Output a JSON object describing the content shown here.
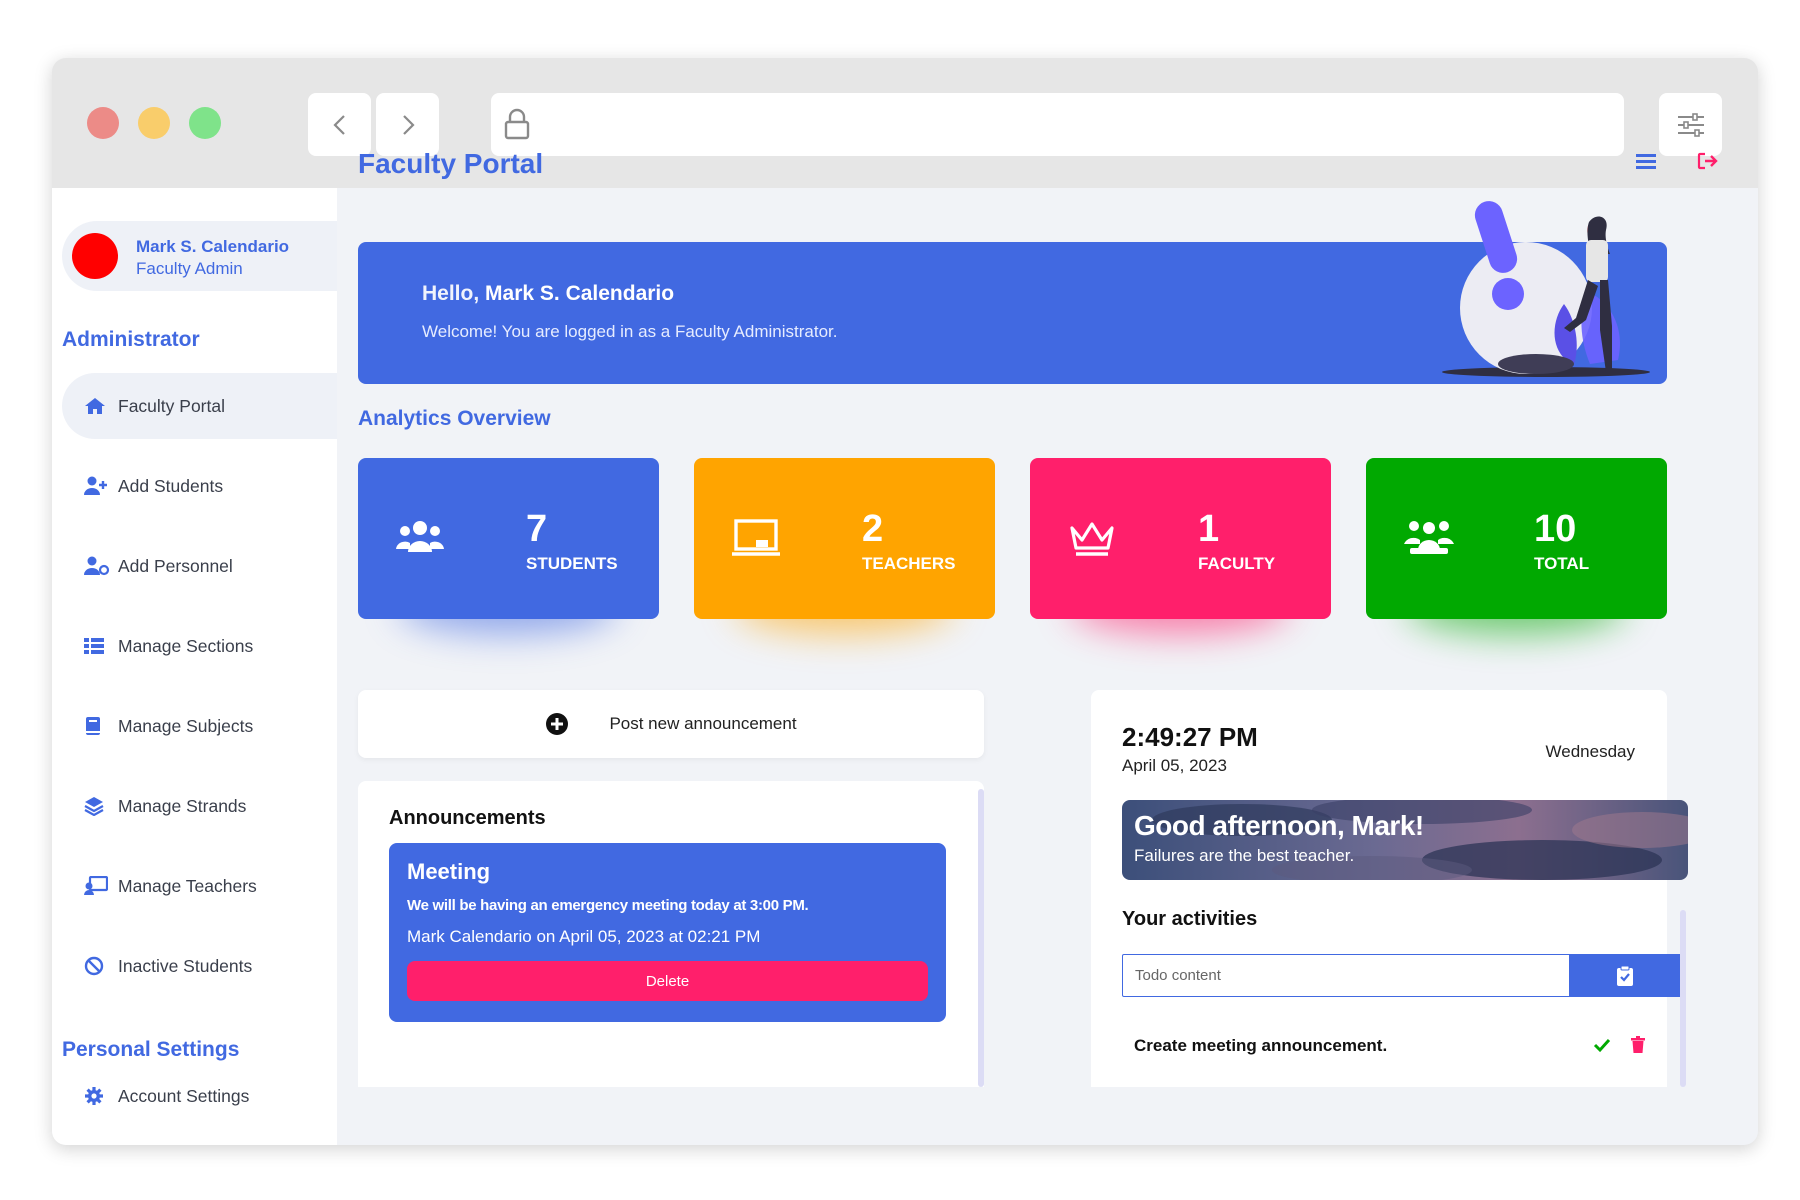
{
  "user": {
    "name": "Mark S. Calendario",
    "role": "Faculty Admin",
    "avatar_color": "#ff0000"
  },
  "sidebar": {
    "section_admin": "Administrator",
    "items": [
      {
        "label": "Faculty Portal",
        "icon": "home-icon"
      },
      {
        "label": "Add Students",
        "icon": "user-plus-icon"
      },
      {
        "label": "Add Personnel",
        "icon": "user-cog-icon"
      },
      {
        "label": "Manage Sections",
        "icon": "list-icon"
      },
      {
        "label": "Manage Subjects",
        "icon": "book-icon"
      },
      {
        "label": "Manage Strands",
        "icon": "layers-icon"
      },
      {
        "label": "Manage Teachers",
        "icon": "teacher-icon"
      },
      {
        "label": "Inactive Students",
        "icon": "ban-icon"
      }
    ],
    "section_personal": "Personal Settings",
    "personal_items": [
      {
        "label": "Account Settings",
        "icon": "gear-icon"
      }
    ]
  },
  "header": {
    "title": "Faculty Portal"
  },
  "hero": {
    "hello": "Hello,",
    "name": "Mark S. Calendario",
    "welcome": "Welcome! You are logged in as a Faculty Administrator."
  },
  "analytics": {
    "title": "Analytics Overview",
    "cards": [
      {
        "value": "7",
        "label": "STUDENTS",
        "color": "#4169e1",
        "icon": "users-icon"
      },
      {
        "value": "2",
        "label": "TEACHERS",
        "color": "#ffa400",
        "icon": "chalkboard-icon"
      },
      {
        "value": "1",
        "label": "FACULTY",
        "color": "#ff1f6b",
        "icon": "crown-icon"
      },
      {
        "value": "10",
        "label": "TOTAL",
        "color": "#01a901",
        "icon": "group-icon"
      }
    ]
  },
  "announcements": {
    "post_label": "Post new announcement",
    "title": "Announcements",
    "items": [
      {
        "title": "Meeting",
        "body": "We will be having an emergency meeting today at 3:00 PM.",
        "meta": "Mark Calendario on April 05, 2023 at 02:21 PM",
        "delete_label": "Delete"
      }
    ]
  },
  "clock": {
    "time": "2:49:27 PM",
    "date": "April 05, 2023",
    "weekday": "Wednesday"
  },
  "greeting": {
    "title": "Good afternoon, Mark!",
    "quote": "Failures are the best teacher."
  },
  "activities": {
    "title": "Your activities",
    "placeholder": "Todo content",
    "items": [
      {
        "text": "Create meeting announcement."
      }
    ]
  },
  "colors": {
    "accent": "#4169e1",
    "danger": "#ff1f6b",
    "success": "#01a901",
    "warning": "#ffa400"
  }
}
